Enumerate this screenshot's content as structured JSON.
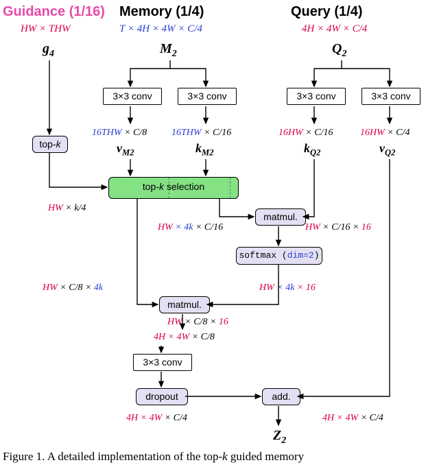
{
  "headers": {
    "guidance": "Guidance (1/16)",
    "memory": "Memory (1/4)",
    "query": "Query (1/4)"
  },
  "dims": {
    "guidance": "HW × THW",
    "memory": "T × 4H × 4W × C/4",
    "query": "4H × 4W × C/4"
  },
  "vars": {
    "g4": "g",
    "g4_sub": "4",
    "M2": "M",
    "M2_sub": "2",
    "Q2": "Q",
    "Q2_sub": "2",
    "vM2": "v",
    "vM2_sub": "M2",
    "kM2": "k",
    "kM2_sub": "M2",
    "kQ2": "k",
    "kQ2_sub": "Q2",
    "vQ2": "v",
    "vQ2_sub": "Q2",
    "Z2": "Z",
    "Z2_sub": "2"
  },
  "ops": {
    "conv": "3×3  conv",
    "topk": "top-k",
    "topk_sel": "top-k selection",
    "matmul": "matmul.",
    "softmax_pre": "softmax (",
    "softmax_dim": "dim=2",
    "softmax_post": ")",
    "dropout": "dropout",
    "add": "add."
  },
  "intermediate": {
    "v_m2_dim_pre": "16THW",
    "v_m2_dim_post": " × C/8",
    "k_m2_dim_pre": "16THW",
    "k_m2_dim_post": " × C/16",
    "k_q2_dim_pre": "16HW",
    "k_q2_dim_post": " × C/16",
    "v_q2_dim_pre": "16HW",
    "v_q2_dim_post": " × C/4",
    "topk_out_hw": "HW",
    "topk_out_k": " × k/4",
    "mm1_left_hw": "HW",
    "mm1_left_mid": " × 4k",
    "mm1_left_post": " × C/16",
    "mm1_right_hw": "HW",
    "mm1_right_mid": " × C/16 × ",
    "mm1_right_16": "16",
    "soft_out_hw": "HW",
    "soft_out_mid": " × 4k",
    "soft_out_16": " × 16",
    "vpath_hw": "HW",
    "vpath_mid": " × C/8 × ",
    "vpath_4k": "4k",
    "mm2_out_hw": "HW",
    "mm2_out_mid": " × C/8 × ",
    "mm2_out_16": "16",
    "reshape_pre": "4H",
    "reshape_mid": " × 4W",
    "reshape_post": " × C/8",
    "final_left_pre": "4H",
    "final_left_mid": " × 4W",
    "final_left_post": " × C/4",
    "final_right_pre": "4H",
    "final_right_mid": " × 4W",
    "final_right_post": " × C/4"
  },
  "caption_pre": "Figure 1.  A detailed implementation of the top-",
  "caption_k": "k",
  "caption_post": " guided memory"
}
